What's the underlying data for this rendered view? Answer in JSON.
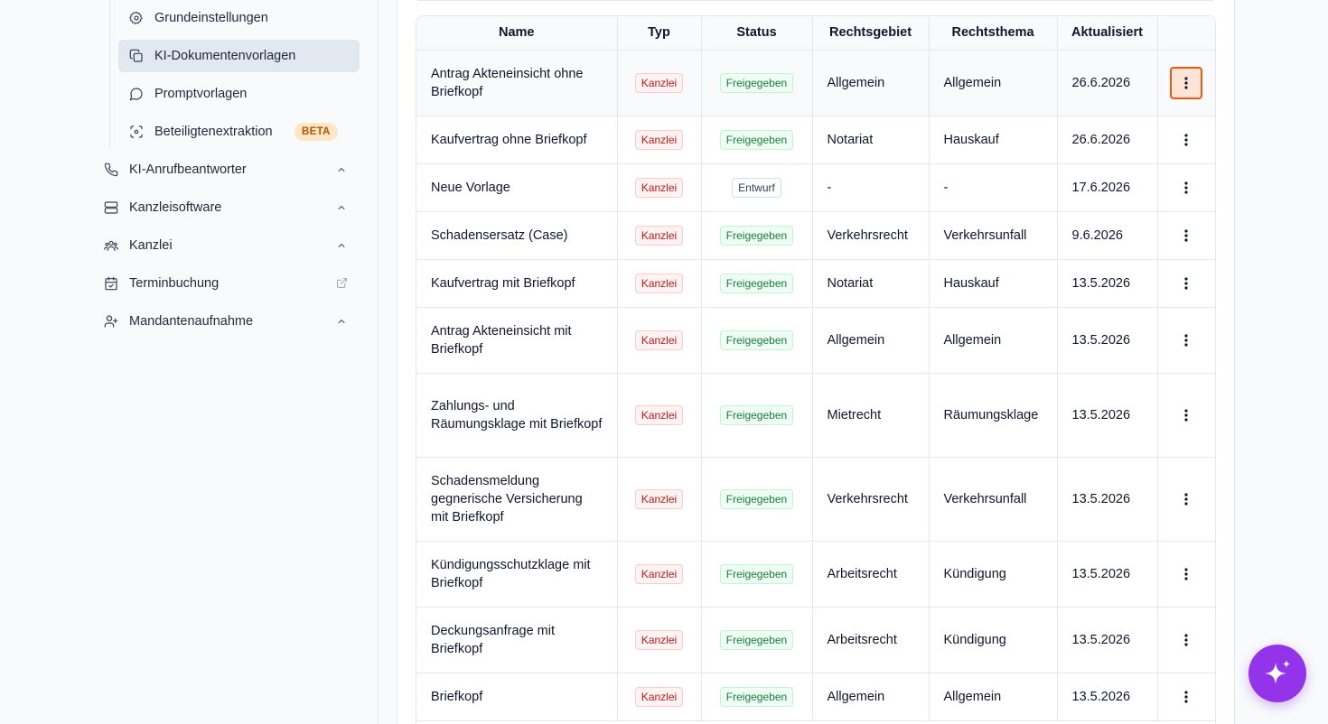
{
  "sidebar": {
    "subitems": [
      {
        "label": "Grundeinstellungen",
        "icon": "gear-icon"
      },
      {
        "label": "KI-Dokumentenvorlagen",
        "icon": "copy-icon",
        "active": true
      },
      {
        "label": "Promptvorlagen",
        "icon": "chat-bubble-icon"
      },
      {
        "label": "Beteiligtenextraktion",
        "icon": "scan-icon",
        "badge": "BETA"
      }
    ],
    "items": [
      {
        "label": "KI-Anrufbeantworter",
        "icon": "phone-icon"
      },
      {
        "label": "Kanzleisoftware",
        "icon": "server-icon"
      },
      {
        "label": "Kanzlei",
        "icon": "users-icon"
      },
      {
        "label": "Terminbuchung",
        "icon": "calendar-icon"
      },
      {
        "label": "Mandantenaufnahme",
        "icon": "user-plus-icon"
      }
    ]
  },
  "table": {
    "headers": [
      "Name",
      "Typ",
      "Status",
      "Rechtsgebiet",
      "Rechtsthema",
      "Aktualisiert",
      ""
    ],
    "rows": [
      {
        "name": "Antrag Akteneinsicht ohne Briefkopf",
        "typ": "Kanzlei",
        "status": "Freigegeben",
        "gebiet": "Allgemein",
        "thema": "Allgemein",
        "date": "26.6.2026"
      },
      {
        "name": "Kaufvertrag ohne Briefkopf",
        "typ": "Kanzlei",
        "status": "Freigegeben",
        "gebiet": "Notariat",
        "thema": "Hauskauf",
        "date": "26.6.2026"
      },
      {
        "name": "Neue Vorlage",
        "typ": "Kanzlei",
        "status": "Entwurf",
        "gebiet": "-",
        "thema": "-",
        "date": "17.6.2026"
      },
      {
        "name": "Schadensersatz (Case)",
        "typ": "Kanzlei",
        "status": "Freigegeben",
        "gebiet": "Verkehrsrecht",
        "thema": "Verkehrsunfall",
        "date": "9.6.2026"
      },
      {
        "name": "Kaufvertrag mit Briefkopf",
        "typ": "Kanzlei",
        "status": "Freigegeben",
        "gebiet": "Notariat",
        "thema": "Hauskauf",
        "date": "13.5.2026"
      },
      {
        "name": "Antrag Akteneinsicht mit Briefkopf",
        "typ": "Kanzlei",
        "status": "Freigegeben",
        "gebiet": "Allgemein",
        "thema": "Allgemein",
        "date": "13.5.2026"
      },
      {
        "name": "Zahlungs- und Räumungsklage mit Briefkopf",
        "typ": "Kanzlei",
        "status": "Freigegeben",
        "gebiet": "Mietrecht",
        "thema": "Räumungsklage",
        "date": "13.5.2026"
      },
      {
        "name": "Schadensmeldung gegnerische Versicherung mit Briefkopf",
        "typ": "Kanzlei",
        "status": "Freigegeben",
        "gebiet": "Verkehrsrecht",
        "thema": "Verkehrsunfall",
        "date": "13.5.2026"
      },
      {
        "name": "Kündigungsschutzklage mit Briefkopf",
        "typ": "Kanzlei",
        "status": "Freigegeben",
        "gebiet": "Arbeitsrecht",
        "thema": "Kündigung",
        "date": "13.5.2026"
      },
      {
        "name": "Deckungsanfrage mit Briefkopf",
        "typ": "Kanzlei",
        "status": "Freigegeben",
        "gebiet": "Arbeitsrecht",
        "thema": "Kündigung",
        "date": "13.5.2026"
      },
      {
        "name": "Briefkopf",
        "typ": "Kanzlei",
        "status": "Freigegeben",
        "gebiet": "Allgemein",
        "thema": "Allgemein",
        "date": "13.5.2026"
      }
    ]
  },
  "fab": {
    "icon": "sparkle-icon"
  },
  "colors": {
    "accent": "#9333ea",
    "kanzlei": "#b91c1c",
    "freigegeben": "#15803d",
    "focus": "#ea580c"
  }
}
